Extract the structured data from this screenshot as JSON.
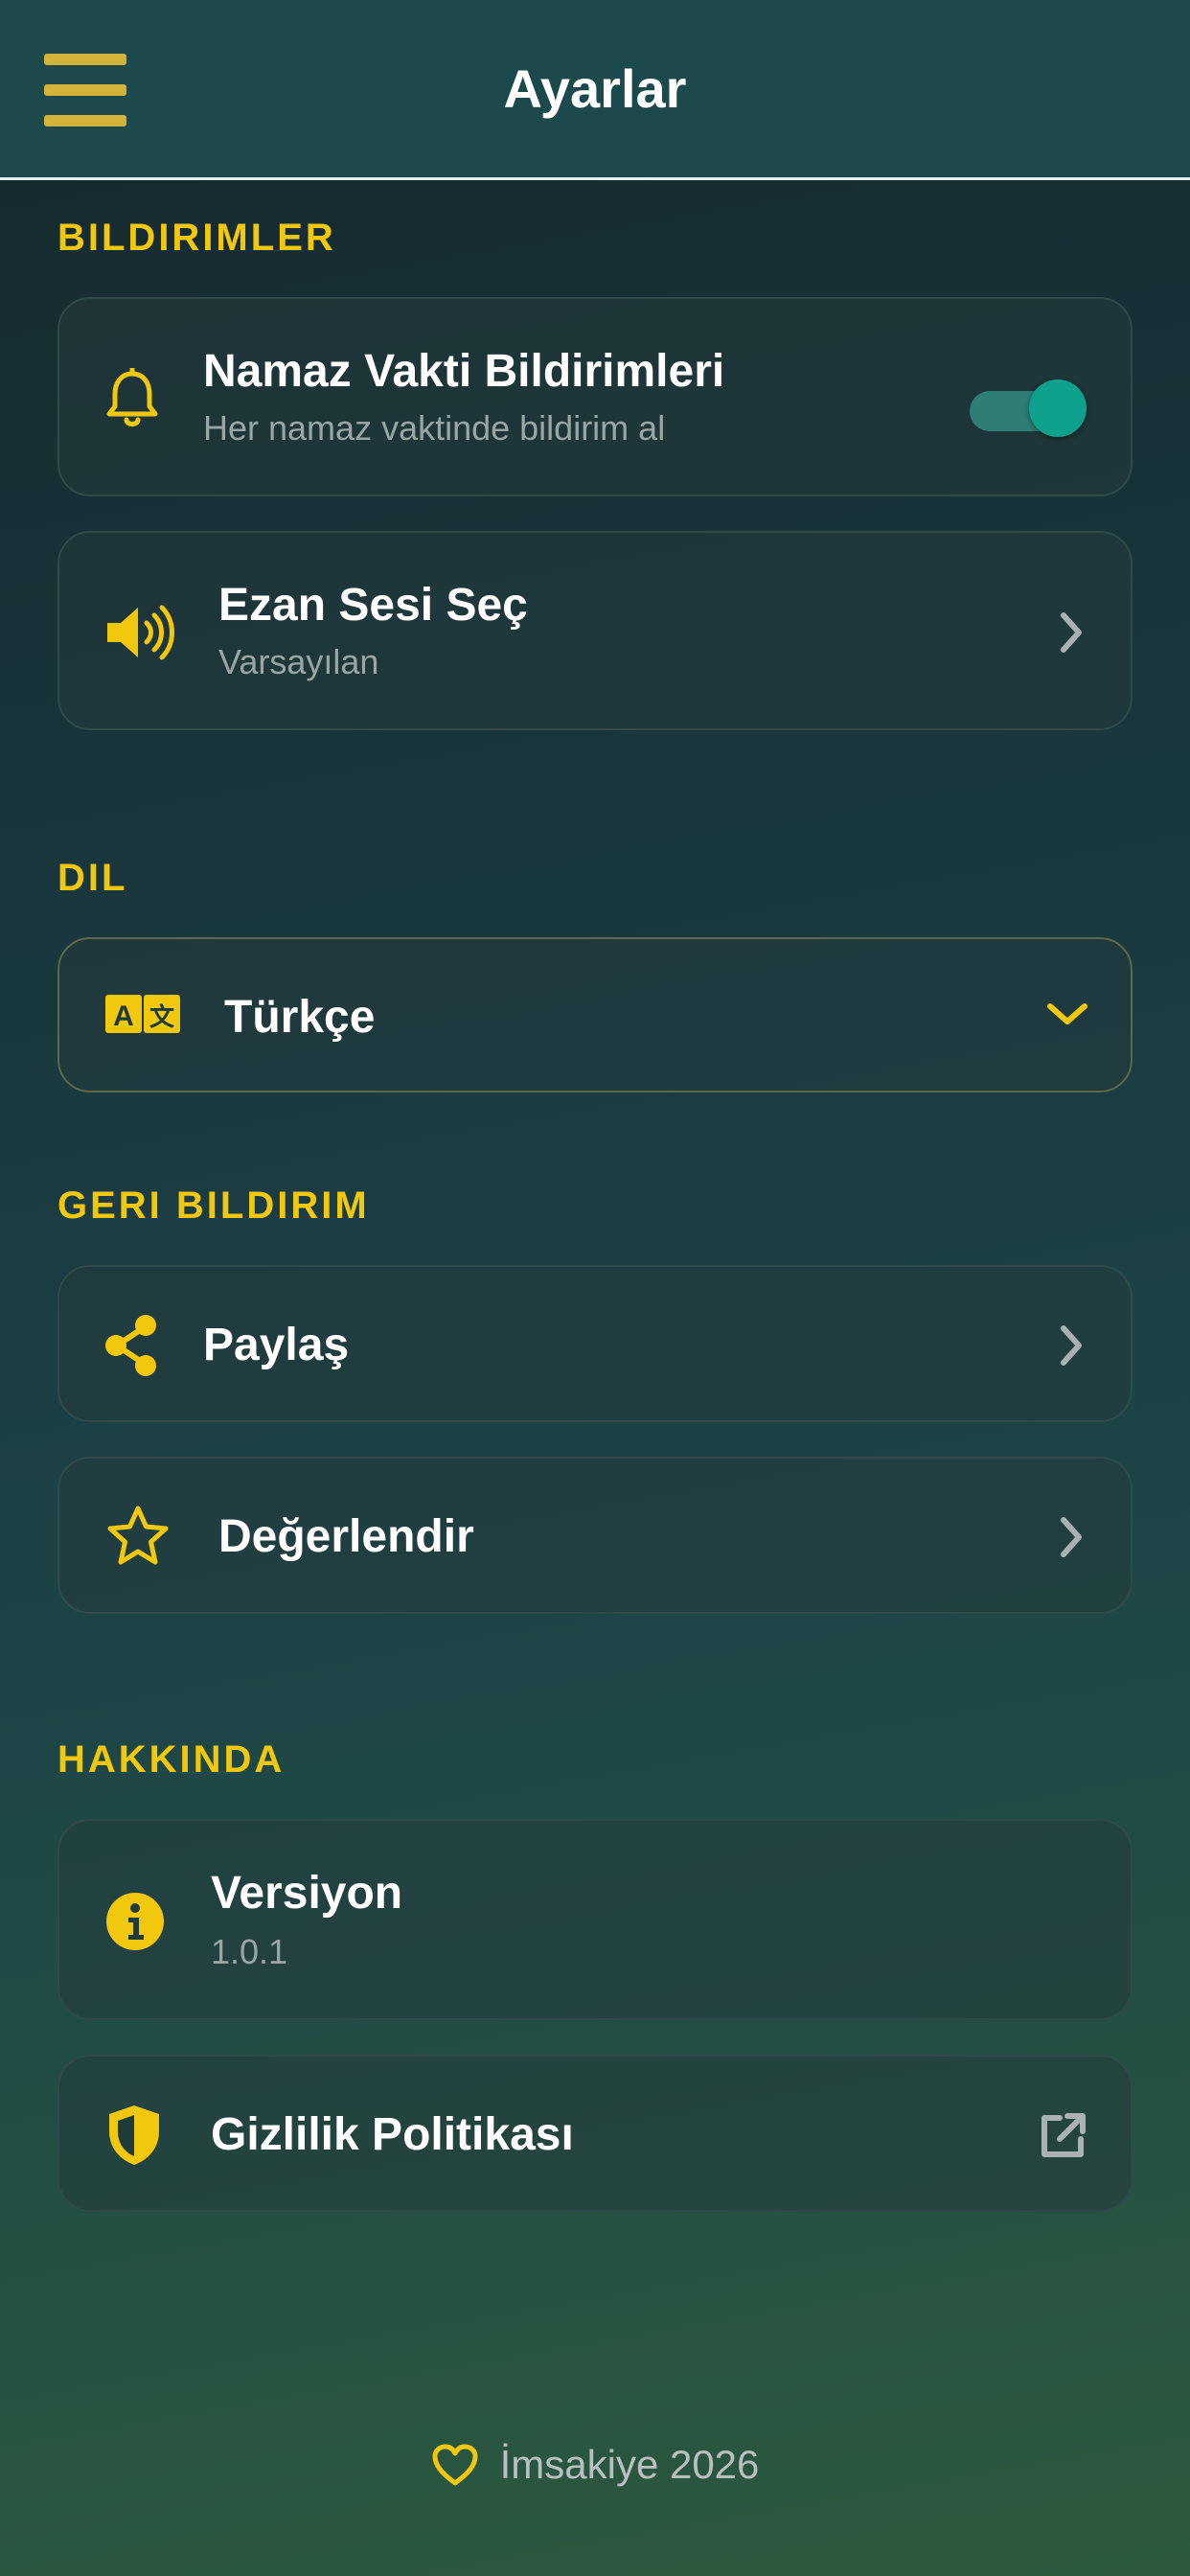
{
  "header": {
    "title": "Ayarlar",
    "menu_icon": "menu-icon"
  },
  "sections": {
    "notifications": {
      "title": "BILDIRIMLER",
      "prayer_notifications": {
        "title": "Namaz Vakti Bildirimleri",
        "subtitle": "Her namaz vaktinde bildirim al",
        "enabled": true,
        "icon": "bell-icon"
      },
      "adhan_sound": {
        "title": "Ezan Sesi Seç",
        "subtitle": "Varsayılan",
        "icon": "speaker-icon"
      }
    },
    "language": {
      "title": "DIL",
      "selected": "Türkçe",
      "icon": "translate-icon"
    },
    "feedback": {
      "title": "GERI BILDIRIM",
      "share": {
        "title": "Paylaş",
        "icon": "share-icon"
      },
      "rate": {
        "title": "Değerlendir",
        "icon": "star-icon"
      }
    },
    "about": {
      "title": "HAKKINDA",
      "version": {
        "title": "Versiyon",
        "value": "1.0.1",
        "icon": "info-icon"
      },
      "privacy": {
        "title": "Gizlilik Politikası",
        "icon": "shield-icon"
      }
    }
  },
  "footer": {
    "text": "İmsakiye 2026",
    "icon": "heart-icon"
  },
  "colors": {
    "accent": "#f2c80f",
    "toggle_on": "#0ea18c",
    "header_bg": "#1c4a4c"
  }
}
